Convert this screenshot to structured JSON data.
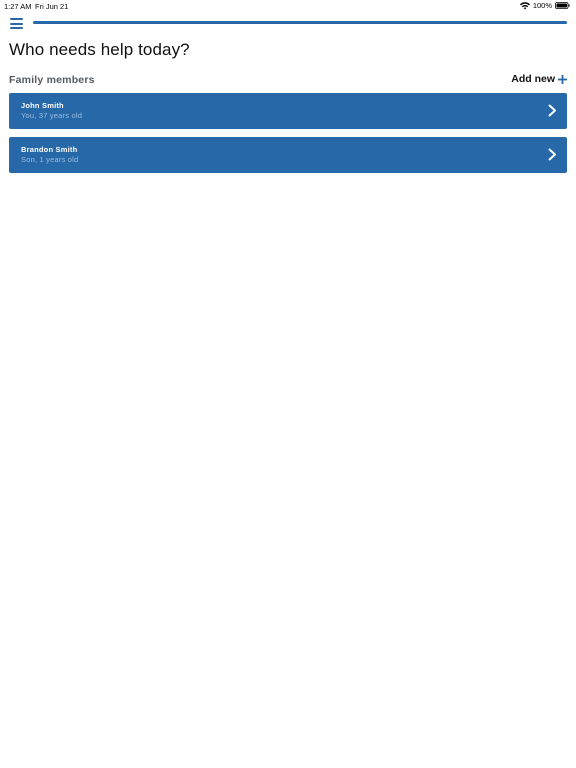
{
  "status_bar": {
    "time": "1:27 AM",
    "date": "Fri Jun 21",
    "battery": "100%",
    "wifi_icon": "wifi-icon",
    "battery_icon": "battery-icon"
  },
  "nav": {
    "menu_icon": "hamburger-menu-icon",
    "progress_percent": 100,
    "accent_color": "#2668a8"
  },
  "title": "Who needs help today?",
  "section": {
    "label": "Family members",
    "add_label": "Add new",
    "add_icon": "plus-icon"
  },
  "members": [
    {
      "name": "John Smith",
      "detail": "You, 37 years old",
      "icon": "chevron-right-icon"
    },
    {
      "name": "Brandon Smith",
      "detail": "Son, 1 years old",
      "icon": "chevron-right-icon"
    }
  ]
}
